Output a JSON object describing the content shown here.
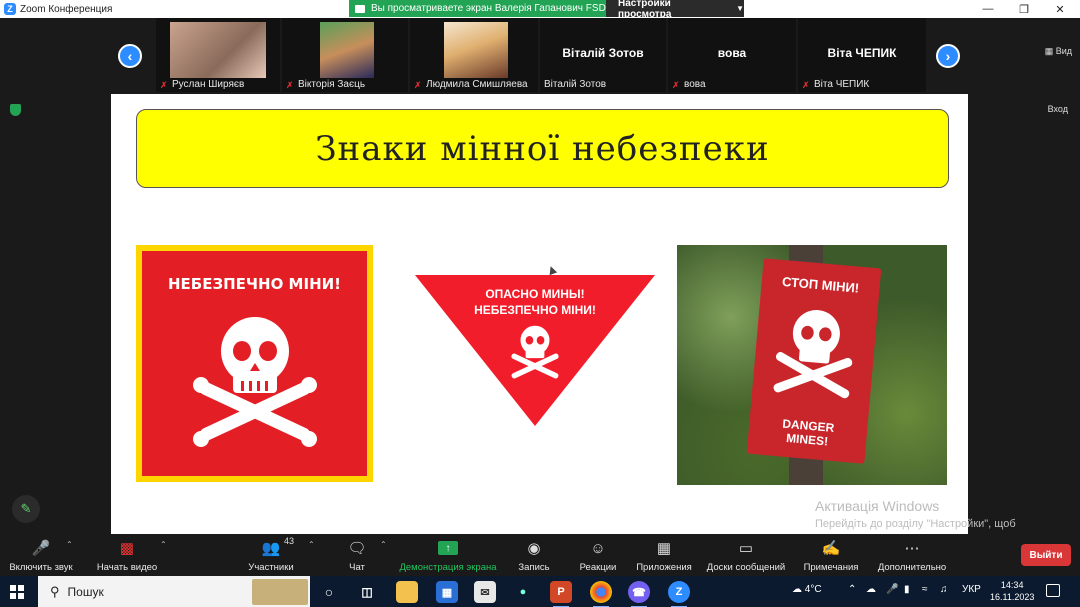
{
  "titlebar": {
    "app_title": "Zoom Конференция",
    "share_banner": "Вы просматриваете экран Валерія Гапанович FSD",
    "view_settings": "Настройки просмотра"
  },
  "gallery": {
    "participants": [
      {
        "name": "Руслан Ширяєв",
        "has_video": true
      },
      {
        "name": "Вікторія Заєць",
        "has_video": true
      },
      {
        "name": "Людмила Смишляева",
        "has_video": true
      },
      {
        "name": "Віталій Зотов",
        "display": "Віталій Зотов",
        "has_video": false
      },
      {
        "name": "вова",
        "display": "вова",
        "has_video": false
      },
      {
        "name": "Віта ЧЕПИК",
        "display": "Віта ЧЕПИК",
        "has_video": false
      }
    ],
    "view_label": "Вид",
    "exit_label": "Вход"
  },
  "slide": {
    "title": "Знаки мінної небезпеки",
    "sign1_text": "НЕБЕЗПЕЧНО МІНИ!",
    "sign2_line1": "ОПАСНО МИНЫ!",
    "sign2_line2": "НЕБЕЗПЕЧНО МІНИ!",
    "sign3_top": "СТОП МІНИ!",
    "sign3_bottom_1": "DANGER",
    "sign3_bottom_2": "MINES!"
  },
  "activation": {
    "title": "Активація Windows",
    "text": "Перейдіть до розділу \"Настройки\", щоб активувати Windows."
  },
  "toolbar": {
    "mute": "Включить звук",
    "video": "Начать видео",
    "participants": "Участники",
    "participants_count": "43",
    "chat": "Чат",
    "share": "Демонстрация экрана",
    "record": "Запись",
    "reactions": "Реакции",
    "apps": "Приложения",
    "whiteboards": "Доски сообщений",
    "notes": "Примечания",
    "more": "Дополнительно",
    "leave": "Выйти"
  },
  "taskbar": {
    "search": "Пошук",
    "weather": "4°C",
    "lang": "УКР",
    "time": "14:34",
    "date": "16.11.2023",
    "weather_badge": "1"
  },
  "colors": {
    "zoom_blue": "#2d8cff",
    "share_green": "#23a455",
    "leave_red": "#d93737",
    "title_yellow": "#ffff00",
    "sign_red": "#e31e24"
  }
}
